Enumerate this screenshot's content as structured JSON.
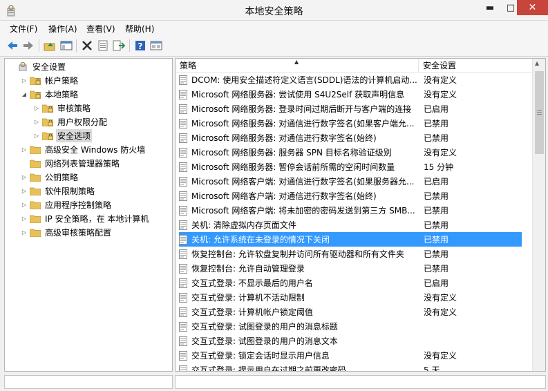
{
  "window": {
    "title": "本地安全策略",
    "minimize_glyph": "▬",
    "maximize_glyph": "□",
    "close_glyph": "✕"
  },
  "menu": [
    "文件(F)",
    "操作(A)",
    "查看(V)",
    "帮助(H)"
  ],
  "toolbar": {
    "buttons": [
      "back-arrow-icon",
      "forward-arrow-icon",
      "up-folder-icon",
      "show-hide-tree-icon",
      "delete-x-icon",
      "properties-icon",
      "export-list-icon",
      "help-icon",
      "view-icon"
    ]
  },
  "tree": [
    {
      "label": "安全设置",
      "level": 0,
      "expanded": true
    },
    {
      "label": "帐户策略",
      "level": 1,
      "expanded": false
    },
    {
      "label": "本地策略",
      "level": 1,
      "expanded": true
    },
    {
      "label": "审核策略",
      "level": 2,
      "expanded": false
    },
    {
      "label": "用户权限分配",
      "level": 2,
      "expanded": false
    },
    {
      "label": "安全选项",
      "level": 2,
      "expanded": false,
      "selected": true
    },
    {
      "label": "高级安全 Windows 防火墙",
      "level": 1,
      "expanded": false
    },
    {
      "label": "网络列表管理器策略",
      "level": 1,
      "no_arrow": true
    },
    {
      "label": "公钥策略",
      "level": 1,
      "expanded": false
    },
    {
      "label": "软件限制策略",
      "level": 1,
      "expanded": false
    },
    {
      "label": "应用程序控制策略",
      "level": 1,
      "expanded": false
    },
    {
      "label": "IP 安全策略，在 本地计算机",
      "level": 1,
      "expanded": false
    },
    {
      "label": "高级审核策略配置",
      "level": 1,
      "expanded": false
    }
  ],
  "list": {
    "columns": {
      "policy": "策略",
      "setting": "安全设置"
    },
    "rows": [
      {
        "policy": "DCOM: 使用安全描述符定义语言(SDDL)语法的计算机启动...",
        "setting": "没有定义"
      },
      {
        "policy": "Microsoft 网络服务器: 尝试使用 S4U2Self 获取声明信息",
        "setting": "没有定义"
      },
      {
        "policy": "Microsoft 网络服务器: 登录时间过期后断开与客户端的连接",
        "setting": "已启用"
      },
      {
        "policy": "Microsoft 网络服务器: 对通信进行数字签名(如果客户端允...",
        "setting": "已禁用"
      },
      {
        "policy": "Microsoft 网络服务器: 对通信进行数字签名(始终)",
        "setting": "已禁用"
      },
      {
        "policy": "Microsoft 网络服务器: 服务器 SPN 目标名称验证级别",
        "setting": "没有定义"
      },
      {
        "policy": "Microsoft 网络服务器: 暂停会话前所需的空闲时间数量",
        "setting": "15 分钟"
      },
      {
        "policy": "Microsoft 网络客户端: 对通信进行数字签名(如果服务器允...",
        "setting": "已启用"
      },
      {
        "policy": "Microsoft 网络客户端: 对通信进行数字签名(始终)",
        "setting": "已禁用"
      },
      {
        "policy": "Microsoft 网络客户端: 将未加密的密码发送到第三方 SMB...",
        "setting": "已禁用"
      },
      {
        "policy": "关机: 清除虚拟内存页面文件",
        "setting": "已禁用"
      },
      {
        "policy": "关机: 允许系统在未登录的情况下关闭",
        "setting": "已禁用",
        "selected": true
      },
      {
        "policy": "恢复控制台: 允许软盘复制并访问所有驱动器和所有文件夹",
        "setting": "已禁用"
      },
      {
        "policy": "恢复控制台: 允许自动管理登录",
        "setting": "已禁用"
      },
      {
        "policy": "交互式登录: 不显示最后的用户名",
        "setting": "已启用"
      },
      {
        "policy": "交互式登录: 计算机不活动限制",
        "setting": "没有定义"
      },
      {
        "policy": "交互式登录: 计算机帐户锁定阈值",
        "setting": "没有定义"
      },
      {
        "policy": "交互式登录: 试图登录的用户的消息标题",
        "setting": ""
      },
      {
        "policy": "交互式登录: 试图登录的用户的消息文本",
        "setting": ""
      },
      {
        "policy": "交互式登录: 锁定会话时显示用户信息",
        "setting": "没有定义"
      },
      {
        "policy": "交互式登录: 提示用户在过期之前更改密码",
        "setting": "5 天"
      }
    ]
  },
  "colors": {
    "selection": "#3399ff",
    "tree_selection": "#d9d9d9",
    "close_button": "#c7453a",
    "folder": "#e8c15a"
  }
}
